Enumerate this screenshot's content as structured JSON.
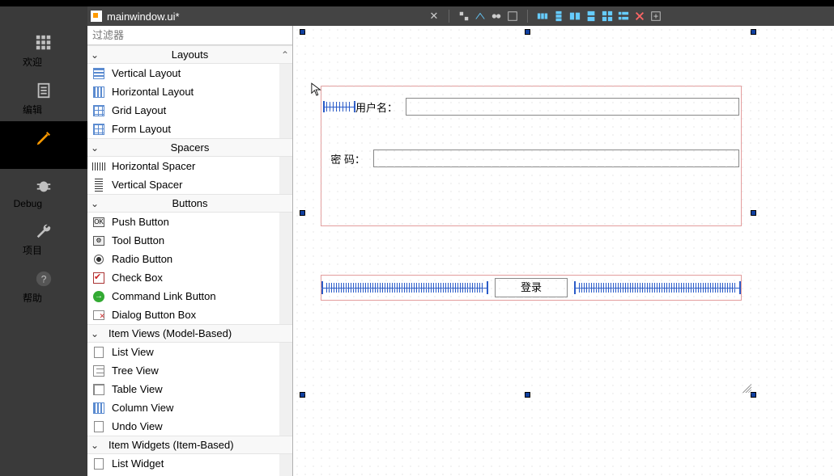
{
  "window": {
    "title": "mainwindow.ui*"
  },
  "rail": {
    "welcome": "欢迎",
    "edit": "编辑",
    "design": "设计",
    "debug": "Debug",
    "project": "项目",
    "help": "帮助"
  },
  "filter": {
    "placeholder": "过滤器"
  },
  "widgetbox": {
    "layouts": {
      "label": "Layouts",
      "vertical": "Vertical Layout",
      "horizontal": "Horizontal Layout",
      "grid": "Grid Layout",
      "form": "Form Layout"
    },
    "spacers": {
      "label": "Spacers",
      "h": "Horizontal Spacer",
      "v": "Vertical Spacer"
    },
    "buttons": {
      "label": "Buttons",
      "push": "Push Button",
      "tool": "Tool Button",
      "radio": "Radio Button",
      "check": "Check Box",
      "clink": "Command Link Button",
      "dlg": "Dialog Button Box"
    },
    "itemviews": {
      "label": "Item Views (Model-Based)",
      "list": "List View",
      "tree": "Tree View",
      "table": "Table View",
      "column": "Column View",
      "undo": "Undo View"
    },
    "itemwidgets": {
      "label": "Item Widgets (Item-Based)",
      "list": "List Widget"
    }
  },
  "form": {
    "username_label": "用户名：",
    "password_label": "密  码：",
    "login_label": "登录"
  }
}
